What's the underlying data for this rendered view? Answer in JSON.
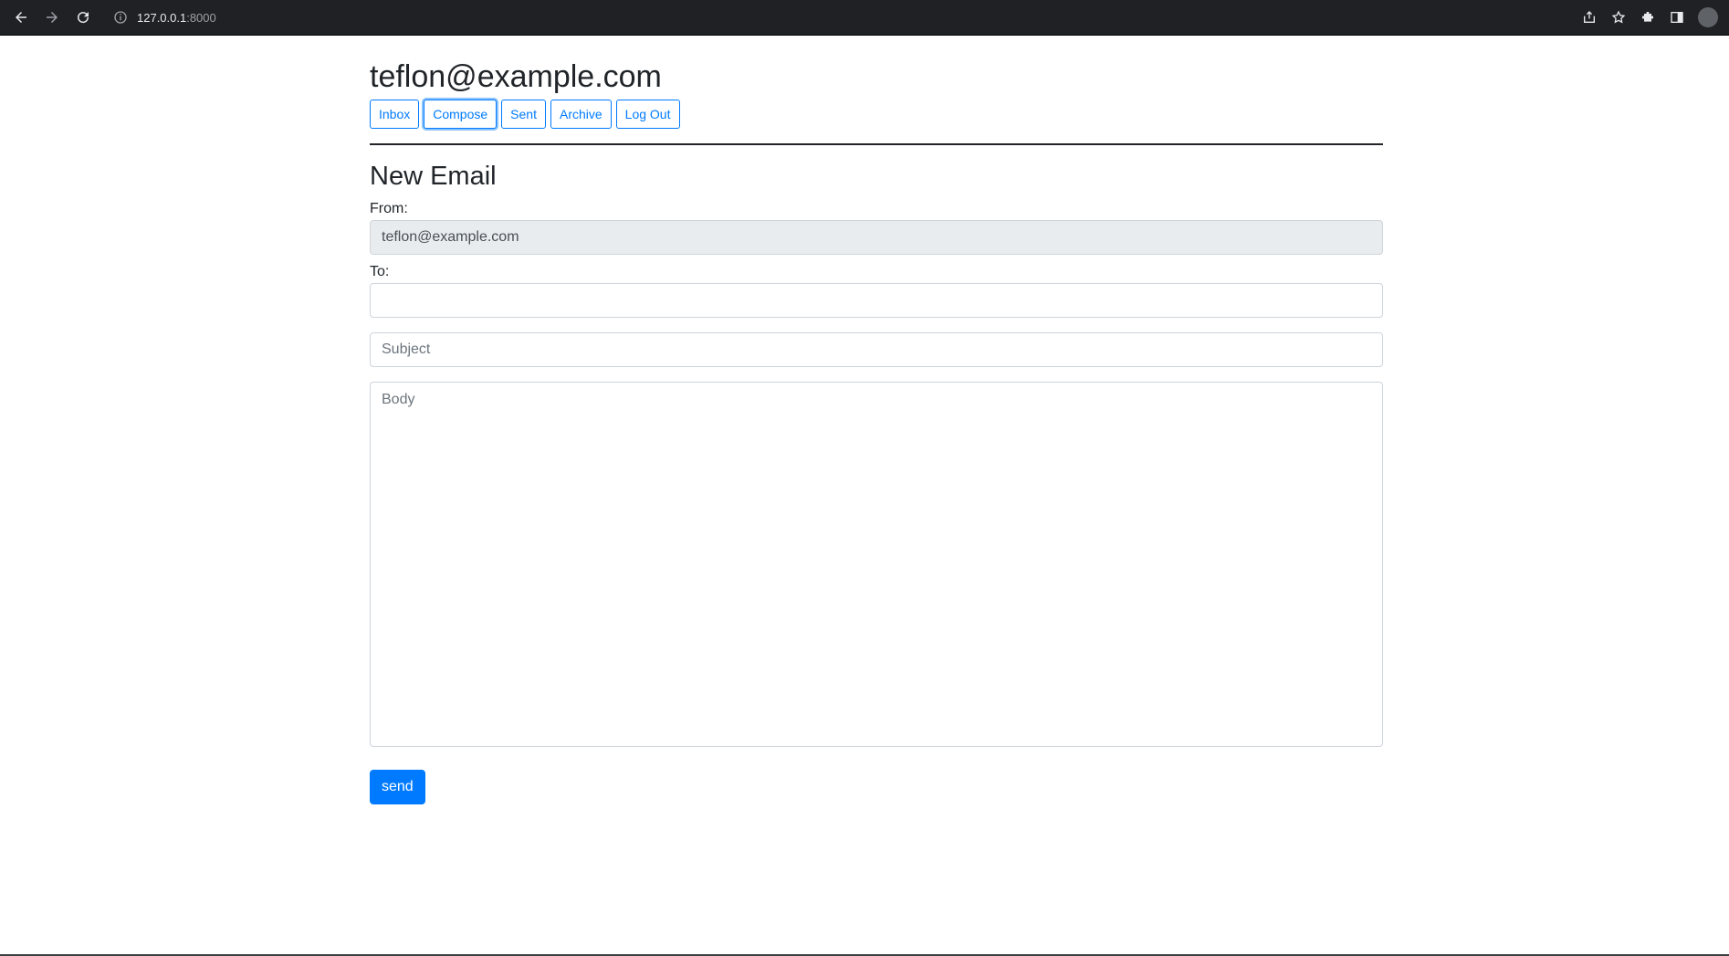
{
  "browser": {
    "url_host": "127.0.0.1",
    "url_port": ":8000"
  },
  "header": {
    "account": "teflon@example.com",
    "nav": [
      {
        "label": "Inbox"
      },
      {
        "label": "Compose"
      },
      {
        "label": "Sent"
      },
      {
        "label": "Archive"
      },
      {
        "label": "Log Out"
      }
    ]
  },
  "compose": {
    "title": "New Email",
    "from_label": "From:",
    "from_value": "teflon@example.com",
    "to_label": "To:",
    "to_value": "",
    "subject_placeholder": "Subject",
    "body_placeholder": "Body",
    "send_label": "send"
  },
  "colors": {
    "accent": "#007bff",
    "chrome": "#202124"
  }
}
